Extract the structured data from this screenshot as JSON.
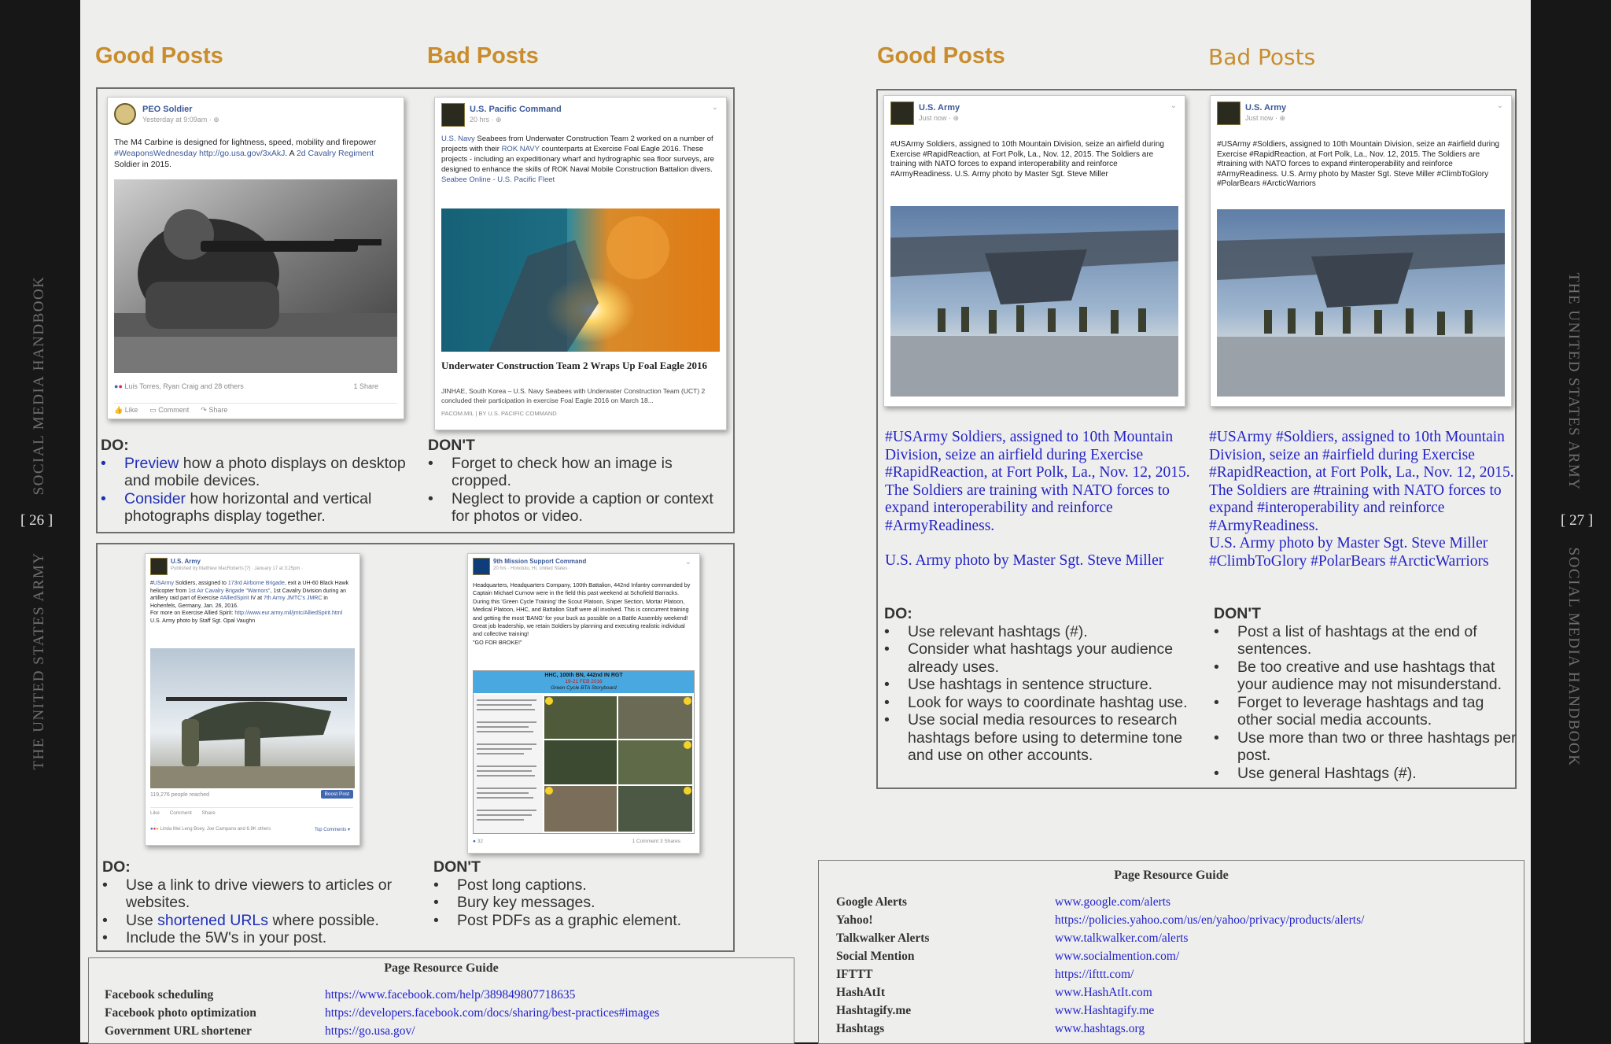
{
  "spread": {
    "left_page_number": "[ 26 ]",
    "right_page_number": "[ 27 ]",
    "left_spine_top": "SOCIAL MEDIA HANDBOOK",
    "left_spine_bottom": "THE UNITED STATES ARMY",
    "right_spine_top": "THE UNITED STATES ARMY",
    "right_spine_bottom": "SOCIAL MEDIA HANDBOOK"
  },
  "left_page": {
    "good_heading": "Good Posts",
    "bad_heading": "Bad Posts",
    "section1": {
      "good_post": {
        "name": "PEO Soldier",
        "time": "Yesterday at 9:09am · ",
        "text_a": "The M4 Carbine is designed for lightness, speed, mobility and firepower ",
        "text_link1": "#WeaponsWednesday http://go.usa.gov/3xAkJ",
        "text_b": ". A ",
        "text_link2": "2d Cavalry Regiment",
        "text_c": " Soldier in 2015.",
        "reactions": "Luis Torres, Ryan Craig and 28 others",
        "shares": "1 Share",
        "like": "Like",
        "comment": "Comment",
        "share": "Share"
      },
      "bad_post": {
        "name": "U.S. Pacific Command",
        "time": "20 hrs · ",
        "text_link1": "U.S. Navy",
        "text_a": " Seabees from Underwater Construction Team 2 worked on a number of projects with their ",
        "text_link2": "ROK NAVY",
        "text_b": " counterparts at Exercise Foal Eagle 2016. These projects - including an expeditionary wharf and hydrographic sea floor surveys, are designed to enhance the skills of ROK Naval Mobile Construction Battalion divers.",
        "text_link3": "Seabee Online - U.S. Pacific Fleet",
        "link_title": "Underwater Construction Team 2 Wraps Up Foal Eagle 2016",
        "link_desc": "JINHAE, South Korea – U.S. Navy Seabees with Underwater Construction Team (UCT) 2 concluded their participation in exercise Foal Eagle 2016 on March 18...",
        "link_source": "PACOM.MIL | BY U.S. PACIFIC COMMAND"
      },
      "do": {
        "label": "DO:",
        "items": [
          {
            "link": "Preview",
            "rest": " how a photo displays on desktop and mobile devices."
          },
          {
            "link": "Consider",
            "rest": " how horizontal and vertical photographs display together."
          }
        ]
      },
      "dont": {
        "label": "DON'T",
        "items": [
          "Forget to check how an image is cropped.",
          "Neglect to provide a caption or context for photos or video."
        ]
      }
    },
    "section2": {
      "good_post": {
        "name": "U.S. Army",
        "time": "Published by Matthew MacRoberts [?] · January 17 at 3:25pm · ",
        "t1_link": "USArmy",
        "t1": " Soldiers, assigned to ",
        "t2_link": "173rd Airborne Brigade",
        "t2": ", exit a UH-60 Black Hawk helicopter from ",
        "t3_link": "1st Air Cavalry Brigade \"Warriors\"",
        "t3": ", 1st Cavalry Division during an artillery raid part of Exercise ",
        "t4_link": "#AlliedSpirit",
        "t4": " IV at ",
        "t5_link": "7th Army JMTC's JMRC",
        "t5": " in Hohenfels, Germany, Jan. 26, 2016.",
        "t6": "For more on Exercise Allied Spirit: ",
        "t6_link": "http://www.eur.army.mil/jmtc/AlliedSpirit.html",
        "t7": "U.S. Army photo by Staff Sgt. Opal Vaughn",
        "reached": "119,276 people reached",
        "boost": "Boost Post",
        "like": "Like",
        "comment": "Comment",
        "share": "Share",
        "reactions": "Linda Mei Leng Boey, Joe Campano and 6.9K others",
        "top_comments": "Top Comments ▾"
      },
      "bad_post": {
        "name": "9th Mission Support Command",
        "time": "20 hrs · Honolulu, HI, United States · ",
        "text": "Headquarters, Headquarters Company, 100th Battalion, 442nd Infantry commanded by Captain Michael Curnow were in the field this past weekend at Schofield Barracks. During this 'Green Cycle Training' the Scout Platoon, Sniper Section, Mortar Platoon, Medical Platoon, HHC, and Battalion Staff were all involved. This is concurrent training and getting the most 'BANG' for your buck as possible on a Battle Assembly weekend! Great job leadership, we retain Soldiers by planning and executing realistic individual and collective training!",
        "text2": "\"GO FOR BROKE!\"",
        "graphic_title": "HHC, 100th BN, 442nd IN RGT",
        "graphic_date": "19-21 FEB 2016",
        "graphic_sub": "Green Cycle BTA Storyboard",
        "likes": "32",
        "stats": "1 Comment  3 Shares"
      },
      "do": {
        "label": "DO:",
        "items": [
          {
            "pre": "Use a link to drive viewers to articles or websites.",
            "link": "",
            "rest": ""
          },
          {
            "pre": "Use ",
            "link": "shortened URLs",
            "rest": " where possible."
          },
          {
            "pre": "Include the 5W's in your post.",
            "link": "",
            "rest": ""
          }
        ]
      },
      "dont": {
        "label": "DON'T",
        "items": [
          "Post long captions.",
          "Bury key messages.",
          "Post PDFs as a graphic element."
        ]
      }
    },
    "resources": {
      "title": "Page Resource Guide",
      "rows": [
        {
          "label": "Facebook scheduling",
          "url": "https://www.facebook.com/help/389849807718635"
        },
        {
          "label": "Facebook photo optimization",
          "url": "https://developers.facebook.com/docs/sharing/best-practices#images"
        },
        {
          "label": "Government URL shortener",
          "url": "https://go.usa.gov/"
        }
      ]
    }
  },
  "right_page": {
    "good_heading": "Good Posts",
    "bad_heading": "Bad Posts",
    "good_post": {
      "name": "U.S. Army",
      "time": "Just now · ",
      "text": "#USArmy Soldiers, assigned to 10th Mountain Division, seize an airfield during Exercise #RapidReaction, at Fort Polk, La., Nov. 12, 2015. The Soldiers are training with NATO forces to expand interoperability and reinforce #ArmyReadiness. U.S. Army photo by Master Sgt. Steve Miller"
    },
    "bad_post": {
      "name": "U.S. Army",
      "time": "Just now · ",
      "text": "#USArmy #Soldiers, assigned to 10th Mountain Division, seize an #airfield during Exercise #RapidReaction, at Fort Polk, La., Nov. 12, 2015. The Soldiers are #training with NATO forces to expand #interoperability and reinforce #ArmyReadiness. U.S. Army photo by Master Sgt. Steve Miller #ClimbToGlory #PolarBears #ArcticWarriors"
    },
    "good_caption": {
      "p1": "#USArmy Soldiers, assigned to 10th Mountain Division, seize an airfield during Exercise #RapidReaction, at Fort Polk, La., Nov. 12, 2015.",
      "p2": "The Soldiers are training with NATO forces to expand interoperability and reinforce #ArmyReadiness.",
      "p3": "U.S. Army photo by Master Sgt. Steve Miller"
    },
    "bad_caption": {
      "p1": "#USArmy #Soldiers, assigned to 10th Mountain Division, seize an #airfield during Exercise #RapidReaction, at Fort Polk, La., Nov. 12, 2015.",
      "p2": "The Soldiers are #training with NATO forces to expand #interoperability and reinforce #ArmyReadiness.",
      "p3": "U.S. Army photo by Master Sgt. Steve Miller #ClimbToGlory #PolarBears #ArcticWarriors"
    },
    "do": {
      "label": "DO:",
      "items": [
        "Use relevant hashtags (#).",
        "Consider what hashtags your audience already uses.",
        "Use hashtags in sentence structure.",
        "Look for ways to coordinate hashtag use.",
        "Use social media resources to research hashtags before using to determine tone and use on other accounts."
      ]
    },
    "dont": {
      "label": "DON'T",
      "items": [
        "Post a list of hashtags at the end of sentences.",
        "Be too creative and use hashtags that your audience may not misunderstand.",
        "Forget to leverage hashtags and tag other social media accounts.",
        "Use more than two or three hashtags per post.",
        "Use general Hashtags (#)."
      ]
    },
    "resources": {
      "title": "Page Resource Guide",
      "rows": [
        {
          "label": "Google Alerts",
          "url": "www.google.com/alerts"
        },
        {
          "label": "Yahoo!",
          "url": "https://policies.yahoo.com/us/en/yahoo/privacy/products/alerts/"
        },
        {
          "label": "Talkwalker Alerts",
          "url": "www.talkwalker.com/alerts"
        },
        {
          "label": "Social Mention",
          "url": "www.socialmention.com/"
        },
        {
          "label": "IFTTT",
          "url": "https://ifttt.com/"
        },
        {
          "label": "HashAtIt",
          "url": "www.HashAtIt.com"
        },
        {
          "label": "Hashtagify.me",
          "url": "www.Hashtagify.me"
        },
        {
          "label": "Hashtags",
          "url": "www.hashtags.org"
        }
      ]
    }
  },
  "colors": {
    "heading_orange": "#c98d2e",
    "link_blue": "#1f2fb5",
    "caption_blue": "#2323c6",
    "page_bg": "#eeeeed",
    "edge_bg": "#171717"
  }
}
